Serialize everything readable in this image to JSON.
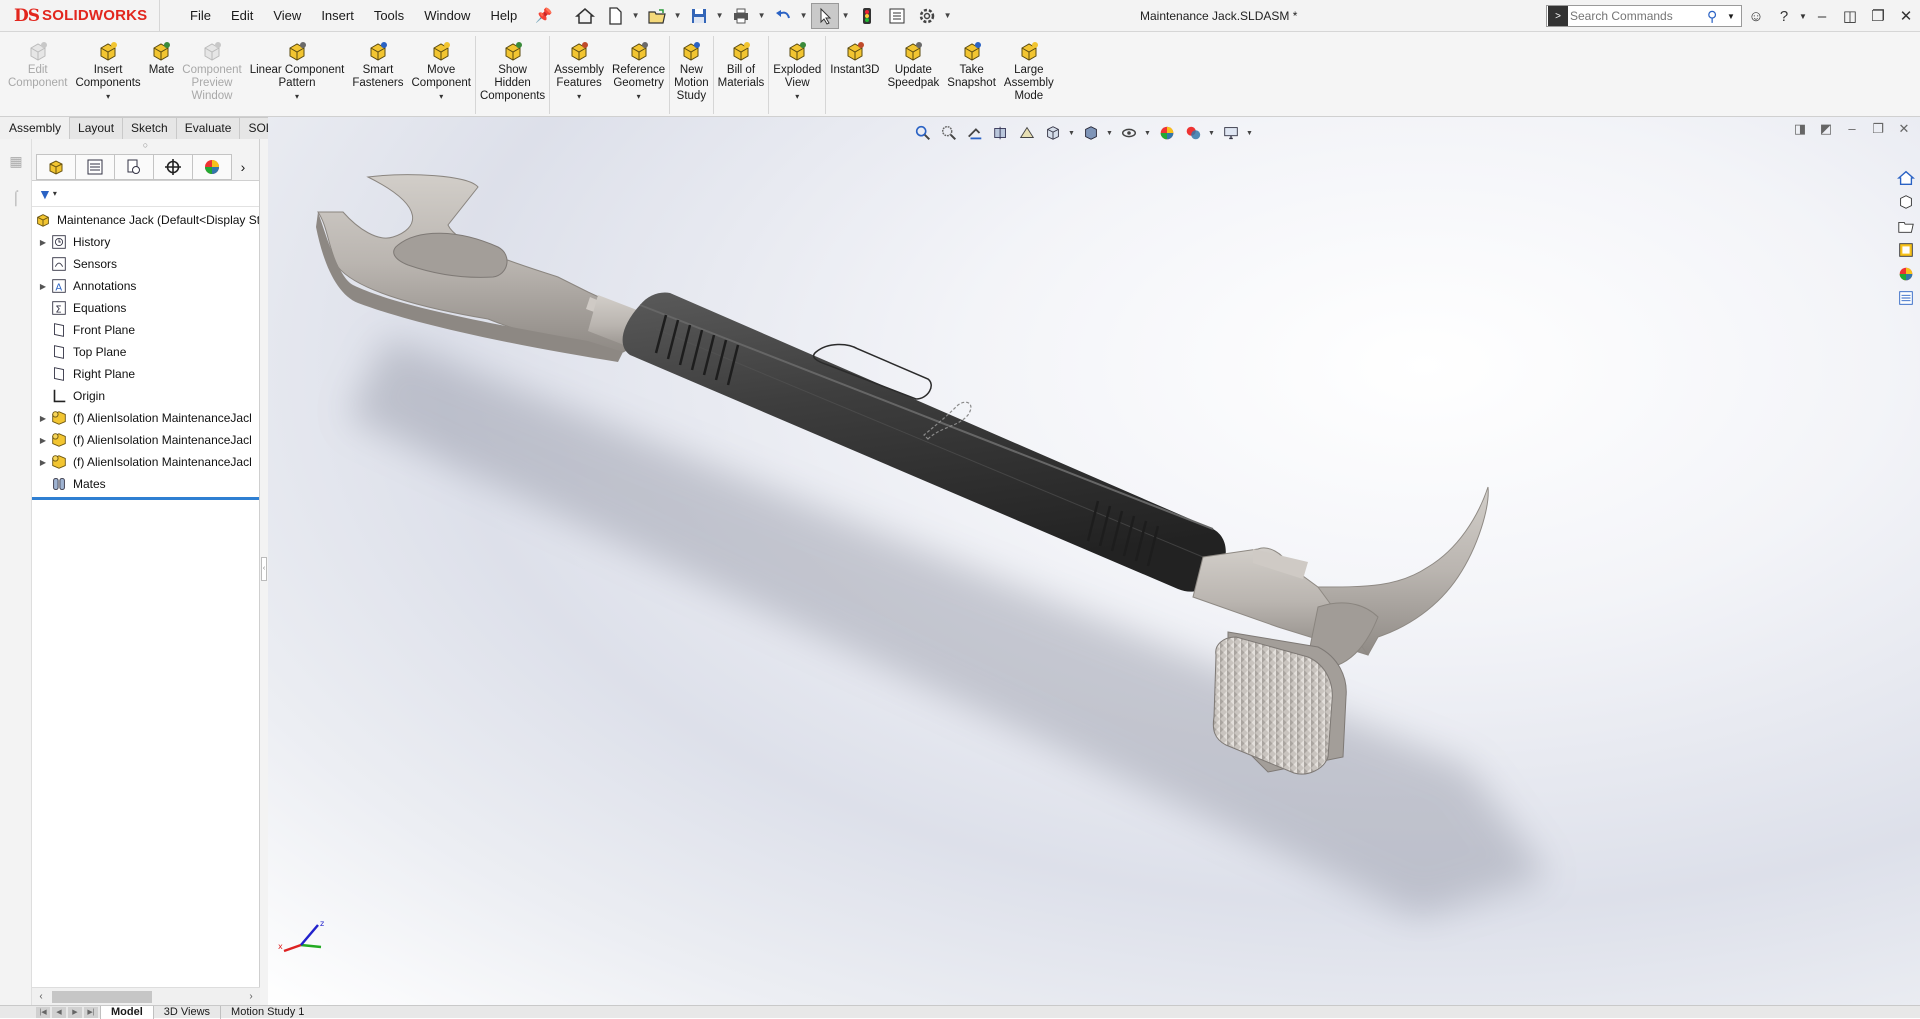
{
  "app": {
    "brand_ds": "DS",
    "brand_name": "SOLIDWORKS",
    "document_title": "Maintenance Jack.SLDASM *"
  },
  "menu": [
    "File",
    "Edit",
    "View",
    "Insert",
    "Tools",
    "Window",
    "Help"
  ],
  "search": {
    "placeholder": "Search Commands"
  },
  "ribbon": [
    {
      "label": "Edit\nComponent",
      "icon": "edit-component-icon",
      "disabled": true,
      "caret": false
    },
    {
      "label": "Insert\nComponents",
      "icon": "insert-components-icon",
      "disabled": false,
      "caret": true
    },
    {
      "label": "Mate",
      "icon": "mate-icon",
      "disabled": false,
      "caret": false
    },
    {
      "label": "Component\nPreview\nWindow",
      "icon": "component-preview-icon",
      "disabled": true,
      "caret": false
    },
    {
      "label": "Linear Component\nPattern",
      "icon": "linear-pattern-icon",
      "disabled": false,
      "caret": true
    },
    {
      "label": "Smart\nFasteners",
      "icon": "smart-fasteners-icon",
      "disabled": false,
      "caret": false
    },
    {
      "label": "Move\nComponent",
      "icon": "move-component-icon",
      "disabled": false,
      "caret": true
    },
    {
      "label": "Show\nHidden\nComponents",
      "icon": "show-hidden-icon",
      "disabled": false,
      "caret": false
    },
    {
      "label": "Assembly\nFeatures",
      "icon": "assembly-features-icon",
      "disabled": false,
      "caret": true
    },
    {
      "label": "Reference\nGeometry",
      "icon": "reference-geometry-icon",
      "disabled": false,
      "caret": true
    },
    {
      "label": "New\nMotion\nStudy",
      "icon": "motion-study-icon",
      "disabled": false,
      "caret": false
    },
    {
      "label": "Bill of\nMaterials",
      "icon": "bom-icon",
      "disabled": false,
      "caret": false
    },
    {
      "label": "Exploded\nView",
      "icon": "exploded-view-icon",
      "disabled": false,
      "caret": true
    },
    {
      "label": "Instant3D",
      "icon": "instant3d-icon",
      "disabled": false,
      "caret": false
    },
    {
      "label": "Update\nSpeedpak",
      "icon": "speedpak-icon",
      "disabled": false,
      "caret": false
    },
    {
      "label": "Take\nSnapshot",
      "icon": "snapshot-icon",
      "disabled": false,
      "caret": false
    },
    {
      "label": "Large\nAssembly\nMode",
      "icon": "large-assembly-icon",
      "disabled": false,
      "caret": false
    }
  ],
  "tabs": [
    "Assembly",
    "Layout",
    "Sketch",
    "Evaluate",
    "SOLIDWORKS Add-Ins"
  ],
  "active_tab": "Assembly",
  "tree": {
    "root": "Maintenance Jack  (Default<Display St",
    "items": [
      {
        "label": "History",
        "icon": "history-icon",
        "expandable": true
      },
      {
        "label": "Sensors",
        "icon": "sensors-icon",
        "expandable": false
      },
      {
        "label": "Annotations",
        "icon": "annotations-icon",
        "expandable": true
      },
      {
        "label": "Equations",
        "icon": "equations-icon",
        "expandable": false
      },
      {
        "label": "Front Plane",
        "icon": "plane-icon",
        "expandable": false
      },
      {
        "label": "Top Plane",
        "icon": "plane-icon",
        "expandable": false
      },
      {
        "label": "Right Plane",
        "icon": "plane-icon",
        "expandable": false
      },
      {
        "label": "Origin",
        "icon": "origin-icon",
        "expandable": false
      },
      {
        "label": "(f) AlienIsolation MaintenanceJacl",
        "icon": "part-icon",
        "expandable": true
      },
      {
        "label": "(f) AlienIsolation MaintenanceJacl",
        "icon": "part-icon",
        "expandable": true
      },
      {
        "label": "(f) AlienIsolation MaintenanceJacl",
        "icon": "part-icon",
        "expandable": true
      },
      {
        "label": "Mates",
        "icon": "mates-icon",
        "expandable": false
      }
    ]
  },
  "bottom_tabs": [
    "Model",
    "3D Views",
    "Motion Study 1"
  ],
  "active_bottom_tab": "Model",
  "colors": {
    "accent": "#2f7fd2",
    "brand": "#e2261d",
    "grip": "#3c3c3c",
    "metal": "#bdb8b3"
  }
}
